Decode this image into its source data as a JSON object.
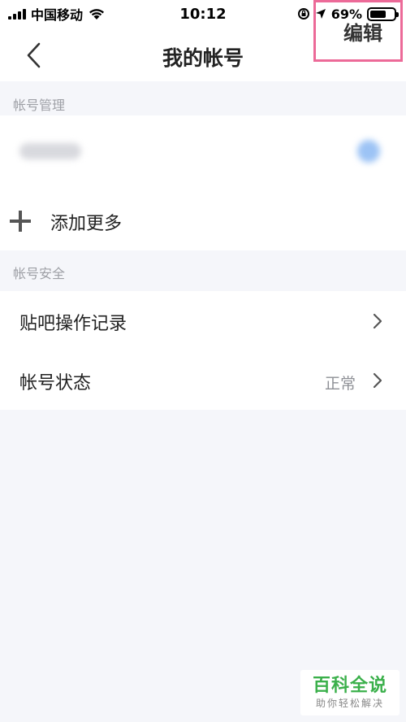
{
  "status_bar": {
    "carrier": "中国移动",
    "time": "10:12",
    "battery_text": "69%",
    "battery_level": 0.69,
    "icons": [
      "signal-icon",
      "wifi-icon",
      "orientation-lock-icon",
      "location-icon",
      "battery-icon"
    ]
  },
  "nav": {
    "title": "我的帐号",
    "edit_label": "编辑",
    "back_icon": "back-chevron-icon",
    "highlight_color": "#ec6a98"
  },
  "account_management": {
    "label": "帐号管理",
    "add_more_label": "添加更多"
  },
  "account_security": {
    "label": "帐号安全",
    "items": [
      {
        "label": "贴吧操作记录",
        "value": ""
      },
      {
        "label": "帐号状态",
        "value": "正常"
      }
    ]
  },
  "watermark": {
    "main": "百科全说",
    "sub": "助你轻松解决",
    "color": "#3bb04b"
  }
}
